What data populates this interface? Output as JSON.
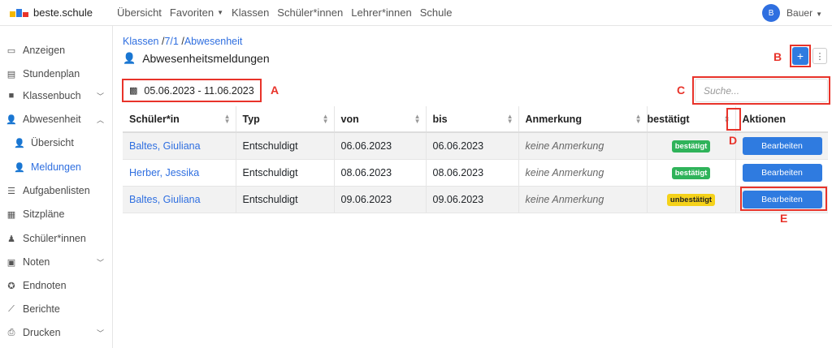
{
  "brand": {
    "name": "beste.schule",
    "colors": [
      "#f5b800",
      "#e8332a",
      "#2f7be0",
      "#2fb35a"
    ]
  },
  "nav": [
    {
      "label": "Übersicht",
      "dropdown": false
    },
    {
      "label": "Favoriten",
      "dropdown": true
    },
    {
      "label": "Klassen",
      "dropdown": false
    },
    {
      "label": "Schüler*innen",
      "dropdown": false
    },
    {
      "label": "Lehrer*innen",
      "dropdown": false
    },
    {
      "label": "Schule",
      "dropdown": false
    }
  ],
  "user": {
    "initial": "B",
    "name": "Bauer"
  },
  "sidebar": [
    {
      "label": "Anzeigen",
      "icon": "display-icon"
    },
    {
      "label": "Stundenplan",
      "icon": "timetable-icon"
    },
    {
      "label": "Klassenbuch",
      "icon": "book-icon",
      "expand": "down"
    },
    {
      "label": "Abwesenheit",
      "icon": "user-check-icon",
      "expand": "up"
    },
    {
      "label": "Übersicht",
      "icon": "user-check-icon",
      "sub": true
    },
    {
      "label": "Meldungen",
      "icon": "user-check-icon",
      "sub": true,
      "active": true
    },
    {
      "label": "Aufgabenlisten",
      "icon": "list-icon"
    },
    {
      "label": "Sitzpläne",
      "icon": "grid-icon"
    },
    {
      "label": "Schüler*innen",
      "icon": "student-icon"
    },
    {
      "label": "Noten",
      "icon": "grade-icon",
      "expand": "down"
    },
    {
      "label": "Endnoten",
      "icon": "award-icon"
    },
    {
      "label": "Berichte",
      "icon": "chart-icon"
    },
    {
      "label": "Drucken",
      "icon": "print-icon",
      "expand": "down"
    }
  ],
  "breadcrumb": {
    "klassen": "Klassen",
    "klasse": "7/1",
    "abwesenheit": "Abwesenheit",
    "sep": "/"
  },
  "page_title": "Abwesenheitsmeldungen",
  "add_label": "+",
  "more_label": "⋮",
  "date_range": "05.06.2023 - 11.06.2023",
  "search_placeholder": "Suche...",
  "annotations": {
    "a": "A",
    "b": "B",
    "c": "C",
    "d": "D",
    "e": "E"
  },
  "table": {
    "headers": [
      "Schüler*in",
      "Typ",
      "von",
      "bis",
      "Anmerkung",
      "bestätigt",
      "Aktionen"
    ],
    "rows": [
      {
        "student": "Baltes, Giuliana",
        "type": "Entschuldigt",
        "from": "06.06.2023",
        "to": "06.06.2023",
        "remark": "keine Anmerkung",
        "status": "bestätigt",
        "status_color": "#2fb35a",
        "action": "Bearbeiten"
      },
      {
        "student": "Herber, Jessika",
        "type": "Entschuldigt",
        "from": "08.06.2023",
        "to": "08.06.2023",
        "remark": "keine Anmerkung",
        "status": "bestätigt",
        "status_color": "#2fb35a",
        "action": "Bearbeiten"
      },
      {
        "student": "Baltes, Giuliana",
        "type": "Entschuldigt",
        "from": "09.06.2023",
        "to": "09.06.2023",
        "remark": "keine Anmerkung",
        "status": "unbestätigt",
        "status_color": "#f5d21a",
        "action": "Bearbeiten"
      }
    ]
  }
}
